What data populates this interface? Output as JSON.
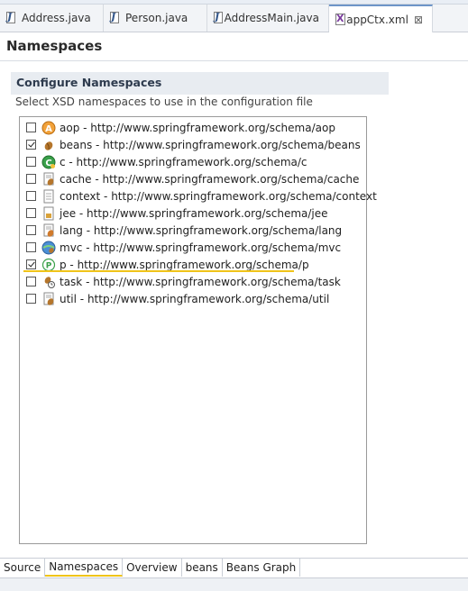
{
  "editor_tabs": [
    {
      "label": "Address.java",
      "icon": "java-file-icon"
    },
    {
      "label": "Person.java",
      "icon": "java-file-icon"
    },
    {
      "label": "AddressMain.java",
      "icon": "java-file-icon"
    },
    {
      "label": "appCtx.xml",
      "icon": "xml-file-icon",
      "active": true
    }
  ],
  "page": {
    "title": "Namespaces",
    "section_title": "Configure Namespaces",
    "section_description": "Select XSD namespaces to use in the configuration file"
  },
  "namespaces": [
    {
      "label": "aop - http://www.springframework.org/schema/aop",
      "checked": false,
      "icon": "aop-icon"
    },
    {
      "label": "beans - http://www.springframework.org/schema/beans",
      "checked": true,
      "icon": "bean-icon"
    },
    {
      "label": "c - http://www.springframework.org/schema/c",
      "checked": false,
      "icon": "c-namespace-icon"
    },
    {
      "label": "cache - http://www.springframework.org/schema/cache",
      "checked": false,
      "icon": "cache-icon"
    },
    {
      "label": "context - http://www.springframework.org/schema/context",
      "checked": false,
      "icon": "context-icon"
    },
    {
      "label": "jee - http://www.springframework.org/schema/jee",
      "checked": false,
      "icon": "jee-icon"
    },
    {
      "label": "lang - http://www.springframework.org/schema/lang",
      "checked": false,
      "icon": "lang-icon"
    },
    {
      "label": "mvc - http://www.springframework.org/schema/mvc",
      "checked": false,
      "icon": "mvc-icon"
    },
    {
      "label": "p - http://www.springframework.org/schema/p",
      "checked": true,
      "icon": "p-namespace-icon"
    },
    {
      "label": "task - http://www.springframework.org/schema/task",
      "checked": false,
      "icon": "task-icon"
    },
    {
      "label": "util - http://www.springframework.org/schema/util",
      "checked": false,
      "icon": "util-icon"
    }
  ],
  "bottom_tabs": [
    {
      "label": "Source"
    },
    {
      "label": "Namespaces",
      "active": true
    },
    {
      "label": "Overview"
    },
    {
      "label": "beans"
    },
    {
      "label": "Beans Graph"
    }
  ],
  "colors": {
    "accent_underline": "#f0c419",
    "section_background": "#e8ecf1",
    "active_tab_top": "#6d95c8"
  }
}
